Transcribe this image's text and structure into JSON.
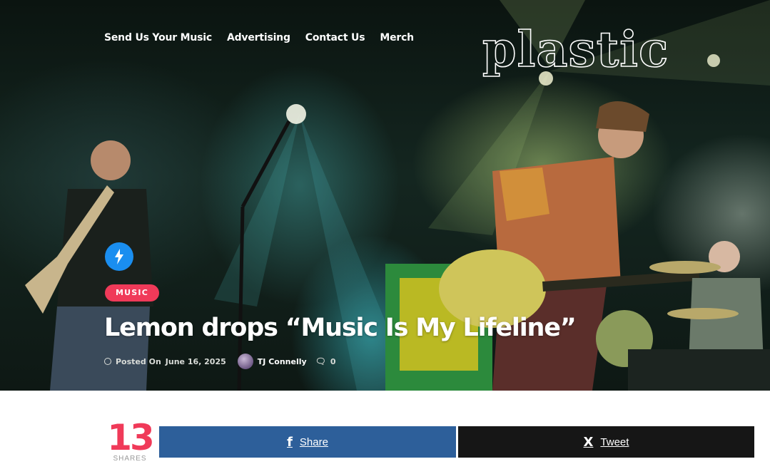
{
  "nav": {
    "items": [
      {
        "label": "Send Us Your Music"
      },
      {
        "label": "Advertising"
      },
      {
        "label": "Contact Us"
      },
      {
        "label": "Merch"
      }
    ]
  },
  "logo": {
    "text": "plastic"
  },
  "article": {
    "category": "MUSIC",
    "title": "Lemon drops “Music Is My Lifeline”",
    "posted_prefix": "Posted On",
    "date": "June 16, 2025",
    "author": "TJ Connelly",
    "comment_count": "0",
    "badge_icon": "lightning-icon"
  },
  "share": {
    "count": "13",
    "label": "SHARES",
    "facebook_label": "Share",
    "twitter_label": "Tweet",
    "facebook_color": "#2d5f9a",
    "twitter_color": "#161616"
  },
  "colors": {
    "accent": "#f03a59",
    "badge_blue": "#1a8ef0"
  }
}
